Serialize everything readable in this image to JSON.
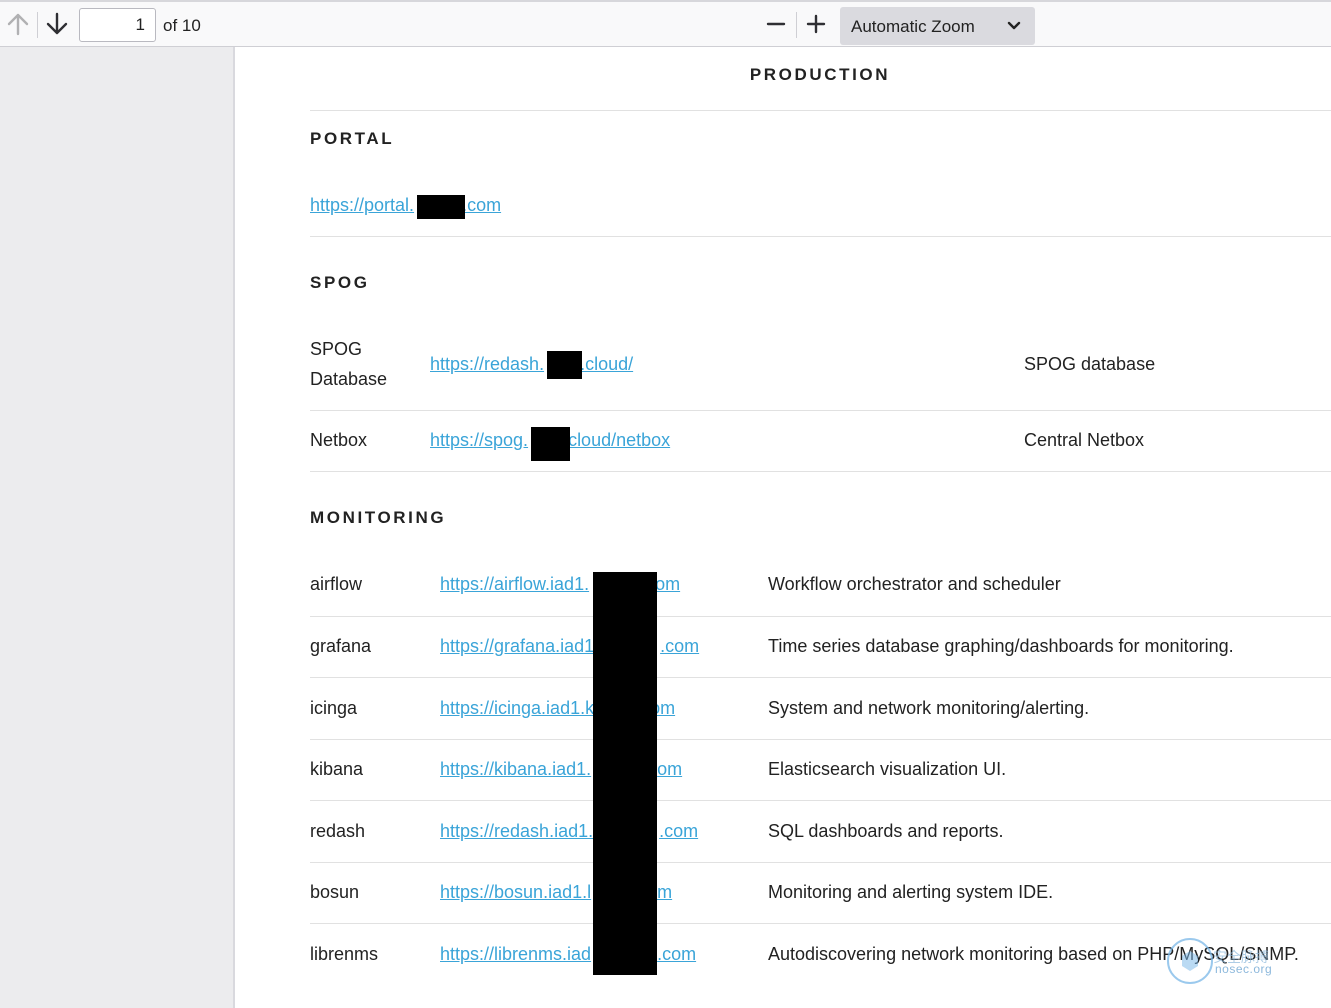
{
  "toolbar": {
    "page_number": "1",
    "page_total": "of 10",
    "zoom_label": "Automatic Zoom"
  },
  "document": {
    "title": "PRODUCTION",
    "portal": {
      "heading": "PORTAL",
      "link_prefix": "https://portal.",
      "link_suffix": ".com"
    },
    "spog": {
      "heading": "SPOG",
      "rows": [
        {
          "name_line1": "SPOG",
          "name_line2": "Database",
          "link_prefix": "https://redash.",
          "link_suffix": ".cloud/",
          "description": "SPOG database"
        },
        {
          "name": "Netbox",
          "link_prefix": "https://spog.",
          "link_suffix": "cloud/netbox",
          "description": "Central Netbox"
        }
      ]
    },
    "monitoring": {
      "heading": "MONITORING",
      "rows": [
        {
          "name": "airflow",
          "link_prefix": "https://airflow.iad1.",
          "link_suffix": "om",
          "description": "Workflow orchestrator and scheduler"
        },
        {
          "name": "grafana",
          "link_prefix": "https://grafana.iad1",
          "link_suffix": ".com",
          "description": "Time series database graphing/dashboards for monitoring."
        },
        {
          "name": "icinga",
          "link_prefix": "https://icinga.iad1.k",
          "link_suffix": "om",
          "description": "System and network monitoring/alerting."
        },
        {
          "name": "kibana",
          "link_prefix": "https://kibana.iad1.",
          "link_suffix": "om",
          "description": "Elasticsearch visualization UI."
        },
        {
          "name": "redash",
          "link_prefix": "https://redash.iad1.",
          "link_suffix": ".com",
          "description": "SQL dashboards and reports."
        },
        {
          "name": "bosun",
          "link_prefix": "https://bosun.iad1.l",
          "link_suffix": "om",
          "description": "Monitoring and alerting system IDE."
        },
        {
          "name": "librenms",
          "link_prefix": "https://librenms.iad",
          "link_suffix": ".com",
          "description": "Autodiscovering network monitoring based on PHP/MySQL/SNMP."
        }
      ]
    }
  },
  "watermark": {
    "text": "nosec.org",
    "title": "安全脉搏"
  }
}
